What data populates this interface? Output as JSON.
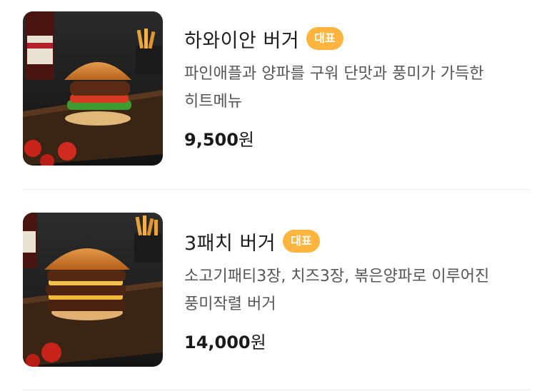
{
  "menu": {
    "items": [
      {
        "name": "하와이안 버거",
        "badge": "대표",
        "description": "파인애플과 양파를 구워 단맛과 풍미가 가득한 히트메뉴",
        "price": "9,500",
        "currency": "원",
        "image": "hawaiian-burger-photo"
      },
      {
        "name": "3패치 버거",
        "badge": "대표",
        "description": "소고기패티3장, 치즈3장, 볶은양파로 이루어진 풍미작렬 버거",
        "price": "14,000",
        "currency": "원",
        "image": "triple-patty-burger-photo"
      }
    ],
    "colors": {
      "badge": "#ffb43d",
      "divider": "#ececec"
    }
  }
}
